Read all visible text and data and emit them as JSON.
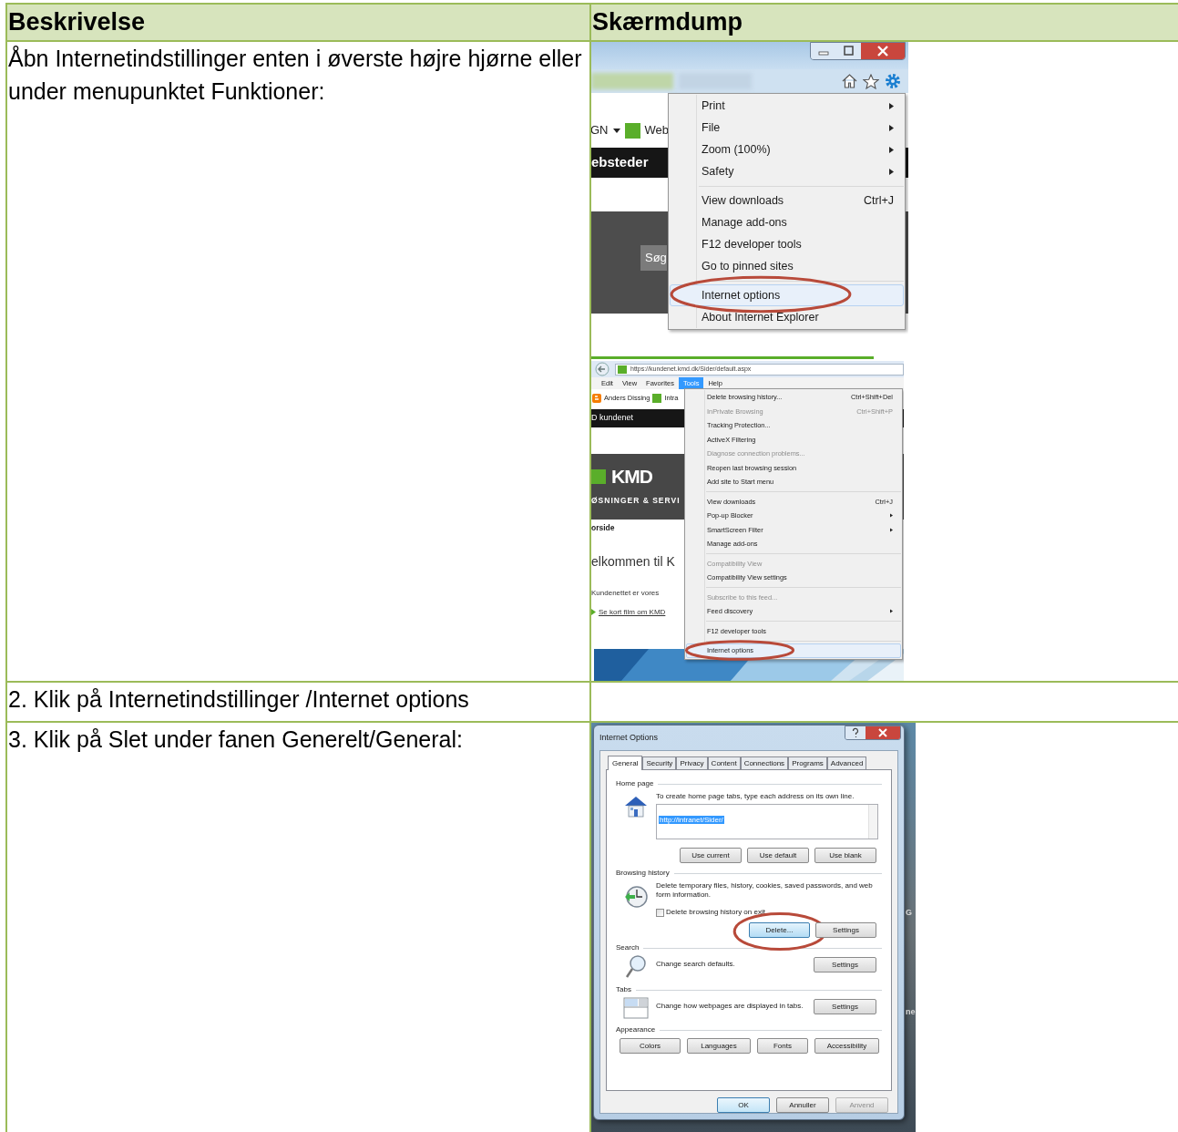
{
  "table": {
    "columns": [
      "Beskrivelse",
      "Skærmdump"
    ],
    "rows": [
      {
        "description": "Åbn Internetindstillinger enten i øverste højre hjørne eller under menupunktet Funktioner:",
        "screenshots": [
          {
            "kind": "gear_menu",
            "favorites": [
              {
                "label": "GN",
                "kind": "dropdown"
              },
              {
                "label": "Web",
                "kind": "site"
              }
            ],
            "nav_bar": "ebsteder",
            "search_button": "Søg",
            "menu": [
              [
                {
                  "label": "Print",
                  "submenu": true,
                  "selected": false
                },
                {
                  "label": "File",
                  "submenu": true,
                  "selected": false
                },
                {
                  "label": "Zoom (100%)",
                  "submenu": true,
                  "selected": false
                },
                {
                  "label": "Safety",
                  "submenu": true,
                  "selected": false
                }
              ],
              [
                {
                  "label": "View downloads",
                  "shortcut": "Ctrl+J",
                  "submenu": false,
                  "selected": false
                },
                {
                  "label": "Manage add-ons",
                  "submenu": false,
                  "selected": false
                },
                {
                  "label": "F12 developer tools",
                  "submenu": false,
                  "selected": false
                },
                {
                  "label": "Go to pinned sites",
                  "submenu": false,
                  "selected": false
                }
              ],
              [
                {
                  "label": "Internet options",
                  "submenu": false,
                  "selected": true
                },
                {
                  "label": "About Internet Explorer",
                  "submenu": false,
                  "selected": false
                }
              ]
            ]
          },
          {
            "kind": "tools_menu",
            "address": "https://kundenet.kmd.dk/Sider/default.aspx",
            "menu_bar": [
              {
                "label": "Edit",
                "selected": false
              },
              {
                "label": "View",
                "selected": false
              },
              {
                "label": "Favorites",
                "selected": false
              },
              {
                "label": "Tools",
                "selected": true
              },
              {
                "label": "Help",
                "selected": false
              }
            ],
            "favorites": [
              {
                "label": "Anders Dissing",
                "kind": "blog"
              },
              {
                "label": "Intra",
                "kind": "site"
              }
            ],
            "page": {
              "site_bar": "D kundenet",
              "logo": "KMD",
              "tagline": "ØSNINGER & SERVI",
              "breadcrumb": "orside",
              "heading": "elkommen til K",
              "intro": "Kundenettet er vores",
              "link": "Se kort film om KMD"
            },
            "menu": [
              [
                {
                  "label": "Delete browsing history...",
                  "shortcut": "Ctrl+Shift+Del",
                  "submenu": false,
                  "disabled": false,
                  "selected": false
                },
                {
                  "label": "InPrivate Browsing",
                  "shortcut": "Ctrl+Shift+P",
                  "submenu": false,
                  "disabled": true,
                  "selected": false
                },
                {
                  "label": "Tracking Protection...",
                  "submenu": false,
                  "disabled": false,
                  "selected": false
                },
                {
                  "label": "ActiveX Filtering",
                  "submenu": false,
                  "disabled": false,
                  "selected": false
                },
                {
                  "label": "Diagnose connection problems...",
                  "submenu": false,
                  "disabled": true,
                  "selected": false
                },
                {
                  "label": "Reopen last browsing session",
                  "submenu": false,
                  "disabled": false,
                  "selected": false
                },
                {
                  "label": "Add site to Start menu",
                  "submenu": false,
                  "disabled": false,
                  "selected": false
                }
              ],
              [
                {
                  "label": "View downloads",
                  "shortcut": "Ctrl+J",
                  "submenu": false,
                  "disabled": false,
                  "selected": false
                },
                {
                  "label": "Pop-up Blocker",
                  "submenu": true,
                  "disabled": false,
                  "selected": false
                },
                {
                  "label": "SmartScreen Filter",
                  "submenu": true,
                  "disabled": false,
                  "selected": false
                },
                {
                  "label": "Manage add-ons",
                  "submenu": false,
                  "disabled": false,
                  "selected": false
                }
              ],
              [
                {
                  "label": "Compatibility View",
                  "submenu": false,
                  "disabled": true,
                  "selected": false
                },
                {
                  "label": "Compatibility View settings",
                  "submenu": false,
                  "disabled": false,
                  "selected": false
                }
              ],
              [
                {
                  "label": "Subscribe to this feed...",
                  "submenu": false,
                  "disabled": true,
                  "selected": false
                },
                {
                  "label": "Feed discovery",
                  "submenu": true,
                  "disabled": false,
                  "selected": false
                }
              ],
              [
                {
                  "label": "F12 developer tools",
                  "submenu": false,
                  "disabled": false,
                  "selected": false
                }
              ],
              [
                {
                  "label": "Internet options",
                  "submenu": false,
                  "disabled": false,
                  "selected": true
                }
              ]
            ]
          }
        ]
      },
      {
        "description": "2. Klik på Internetindstillinger /Internet options"
      },
      {
        "description": "3. Klik på Slet under fanen Generelt/General:",
        "screenshots": [
          {
            "kind": "options_dialog",
            "title": "Internet Options",
            "tabs": [
              {
                "label": "General",
                "selected": true
              },
              {
                "label": "Security",
                "selected": false
              },
              {
                "label": "Privacy",
                "selected": false
              },
              {
                "label": "Content",
                "selected": false
              },
              {
                "label": "Connections",
                "selected": false
              },
              {
                "label": "Programs",
                "selected": false
              },
              {
                "label": "Advanced",
                "selected": false
              }
            ],
            "sections": [
              {
                "kind": "home_page",
                "heading": "Home page",
                "text": "To create home page tabs, type each address on its own line.",
                "value": "http://intranet/Sider/",
                "buttons": [
                  {
                    "label": "Use current",
                    "highlighted": false
                  },
                  {
                    "label": "Use default",
                    "highlighted": false
                  },
                  {
                    "label": "Use blank",
                    "highlighted": false
                  }
                ]
              },
              {
                "kind": "history",
                "heading": "Browsing history",
                "text": "Delete temporary files, history, cookies, saved passwords, and web form information.",
                "checkbox": {
                  "label": "Delete browsing history on exit",
                  "checked": false
                },
                "buttons": [
                  {
                    "label": "Delete...",
                    "highlighted": true
                  },
                  {
                    "label": "Settings",
                    "highlighted": false
                  }
                ]
              },
              {
                "kind": "search",
                "heading": "Search",
                "text": "Change search defaults.",
                "buttons": [
                  {
                    "label": "Settings",
                    "highlighted": false
                  }
                ]
              },
              {
                "kind": "tabs",
                "heading": "Tabs",
                "text": "Change how webpages are displayed in tabs.",
                "buttons": [
                  {
                    "label": "Settings",
                    "highlighted": false
                  }
                ]
              },
              {
                "kind": "appearance",
                "heading": "Appearance",
                "buttons": [
                  {
                    "label": "Colors",
                    "highlighted": false
                  },
                  {
                    "label": "Languages",
                    "highlighted": false
                  },
                  {
                    "label": "Fonts",
                    "highlighted": false
                  },
                  {
                    "label": "Accessibility",
                    "highlighted": false
                  }
                ]
              }
            ],
            "footer_buttons": [
              {
                "label": "OK",
                "default": true,
                "disabled": false
              },
              {
                "label": "Annuller",
                "default": false,
                "disabled": false
              },
              {
                "label": "Anvend",
                "default": false,
                "disabled": true
              }
            ],
            "background_fragments": [
              "G",
              "ne"
            ]
          }
        ]
      }
    ]
  }
}
